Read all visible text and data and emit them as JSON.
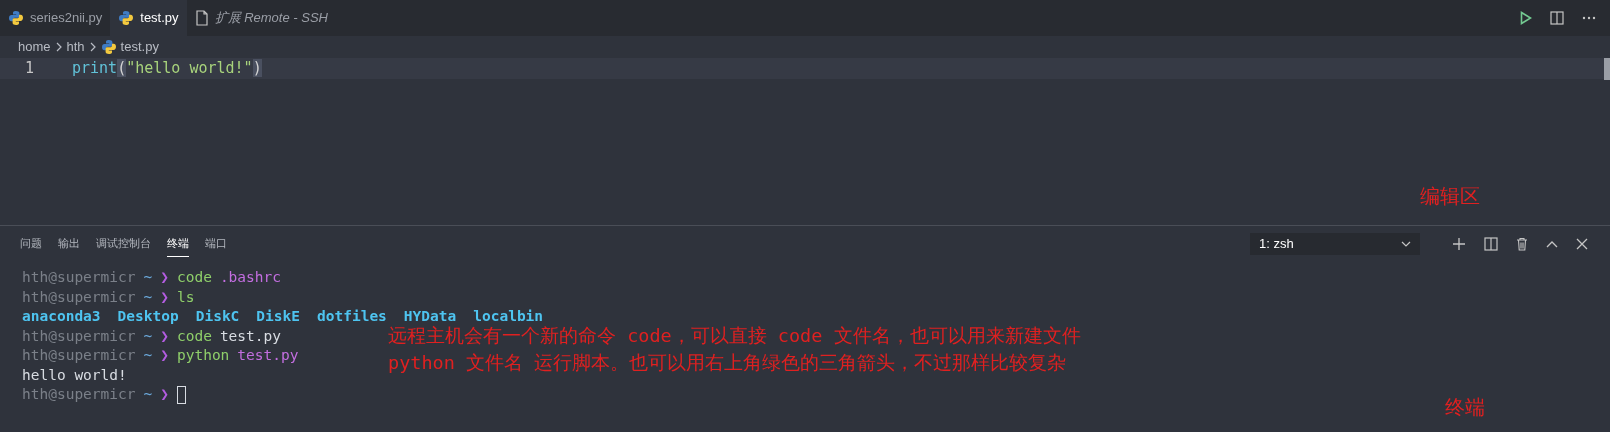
{
  "editor_tabs": [
    {
      "label": "series2nii.py",
      "kind": "python",
      "selected": false,
      "preview": false
    },
    {
      "label": "test.py",
      "kind": "python",
      "selected": true,
      "preview": false
    },
    {
      "label": "扩展 Remote - SSH",
      "kind": "file",
      "selected": false,
      "preview": true
    }
  ],
  "breadcrumb": [
    "home",
    "hth",
    "test.py"
  ],
  "editor": {
    "lines": [
      {
        "number": "1",
        "tokens": [
          {
            "kind": "func",
            "text": "print"
          },
          {
            "kind": "bracket",
            "text": "("
          },
          {
            "kind": "string",
            "text": "\"hello world!\""
          },
          {
            "kind": "bracket",
            "text": ")"
          }
        ]
      }
    ]
  },
  "panel_tabs": [
    {
      "label": "问题",
      "selected": false
    },
    {
      "label": "输出",
      "selected": false
    },
    {
      "label": "调试控制台",
      "selected": false
    },
    {
      "label": "终端",
      "selected": true
    },
    {
      "label": "端口",
      "selected": false
    }
  ],
  "terminal_select": {
    "value": "1: zsh"
  },
  "terminal_lines": [
    [
      {
        "kind": "user",
        "text": "hth@supermicr"
      },
      {
        "kind": "tilde",
        "text": "~"
      },
      {
        "kind": "arrow",
        "text": "❯"
      },
      {
        "kind": "cmd",
        "text": "code"
      },
      {
        "kind": "arg",
        "text": ".bashrc"
      }
    ],
    [
      {
        "kind": "user",
        "text": "hth@supermicr"
      },
      {
        "kind": "tilde",
        "text": "~"
      },
      {
        "kind": "arrow",
        "text": "❯"
      },
      {
        "kind": "cmd",
        "text": "ls"
      }
    ],
    [
      {
        "kind": "dir",
        "text": "anaconda3"
      },
      {
        "kind": "dir",
        "text": "Desktop"
      },
      {
        "kind": "dir",
        "text": "DiskC"
      },
      {
        "kind": "dir",
        "text": "DiskE"
      },
      {
        "kind": "dir",
        "text": "dotfiles"
      },
      {
        "kind": "dir",
        "text": "HYData"
      },
      {
        "kind": "dir",
        "text": "localbin"
      }
    ],
    [
      {
        "kind": "user",
        "text": "hth@supermicr"
      },
      {
        "kind": "tilde",
        "text": "~"
      },
      {
        "kind": "arrow",
        "text": "❯"
      },
      {
        "kind": "cmd",
        "text": "code"
      },
      {
        "kind": "plain",
        "text": "test.py"
      }
    ],
    [
      {
        "kind": "user",
        "text": "hth@supermicr"
      },
      {
        "kind": "tilde",
        "text": "~"
      },
      {
        "kind": "arrow",
        "text": "❯"
      },
      {
        "kind": "cmd",
        "text": "python"
      },
      {
        "kind": "arg",
        "text": "test.py"
      }
    ],
    [
      {
        "kind": "plain",
        "text": "hello world!"
      }
    ],
    [
      {
        "kind": "user",
        "text": "hth@supermicr"
      },
      {
        "kind": "tilde",
        "text": "~"
      },
      {
        "kind": "arrow",
        "text": "❯"
      },
      {
        "kind": "cursor"
      }
    ]
  ],
  "annotations": [
    {
      "kind": "editor",
      "text": "编辑区"
    },
    {
      "kind": "note",
      "text": "远程主机会有一个新的命令 code，可以直接 code 文件名，也可以用来新建文件"
    },
    {
      "kind": "note",
      "text": "python 文件名 运行脚本。也可以用右上角绿色的三角箭头，不过那样比较复杂"
    },
    {
      "kind": "terminal",
      "text": "终端"
    }
  ]
}
